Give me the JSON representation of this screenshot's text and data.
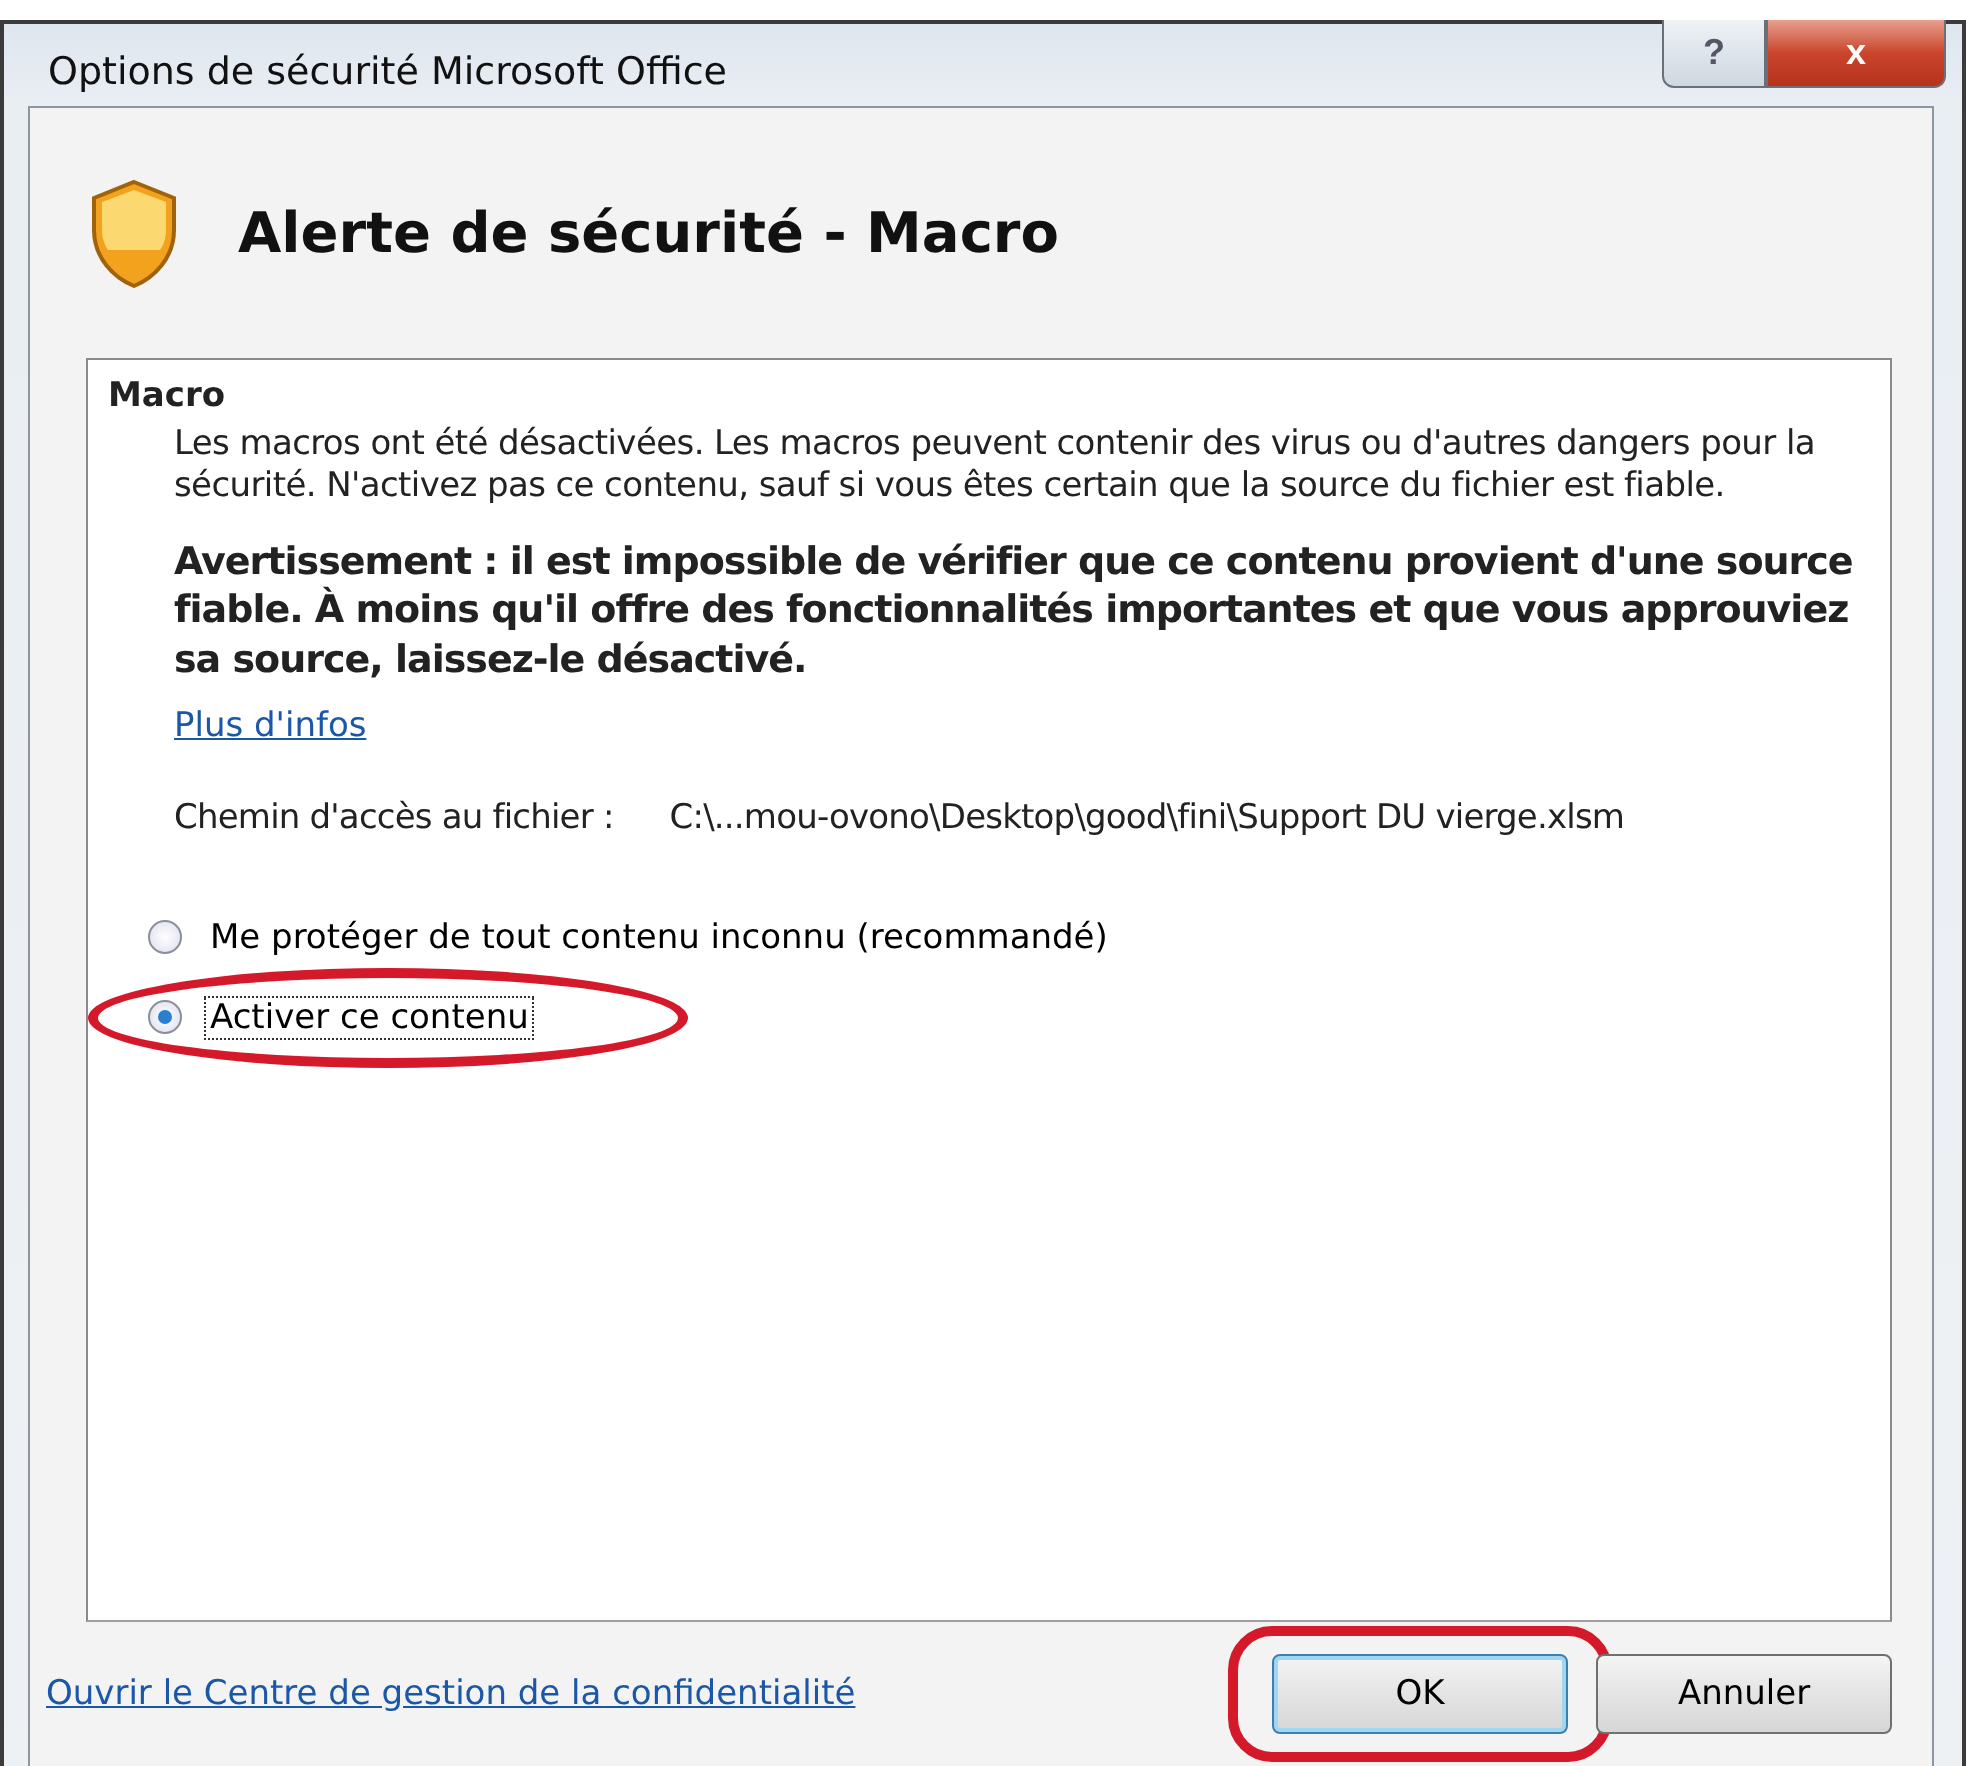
{
  "window": {
    "title": "Options de sécurité Microsoft Office",
    "controls": [
      "?",
      "x"
    ]
  },
  "header": {
    "title": "Alerte de sécurité - Macro"
  },
  "section": {
    "title": "Macro",
    "description": "Les macros ont été désactivées. Les macros peuvent contenir des virus ou d'autres dangers pour la sécurité. N'activez pas ce contenu, sauf si vous êtes certain que la source du fichier est fiable.",
    "warning": "Avertissement : il est impossible de vérifier que ce contenu provient d'une source fiable. À moins qu'il offre des fonctionnalités importantes et que vous approuviez sa source, laissez-le désactivé.",
    "link": "Plus d'infos",
    "path_label": "Chemin d'accès au fichier :",
    "path_value": "C:\\...mou-ovono\\Desktop\\good\\fini\\Support DU vierge.xlsm"
  },
  "options": [
    {
      "label": "Me protéger de tout contenu inconnu (recommandé)",
      "selected": false,
      "circled": false
    },
    {
      "label": "Activer ce contenu",
      "selected": true,
      "circled": true
    }
  ],
  "footer": {
    "link": "Ouvrir le Centre de gestion de la confidentialité",
    "buttons": [
      {
        "label": "OK",
        "circled": true
      },
      {
        "label": "Annuler",
        "circled": false
      }
    ]
  }
}
